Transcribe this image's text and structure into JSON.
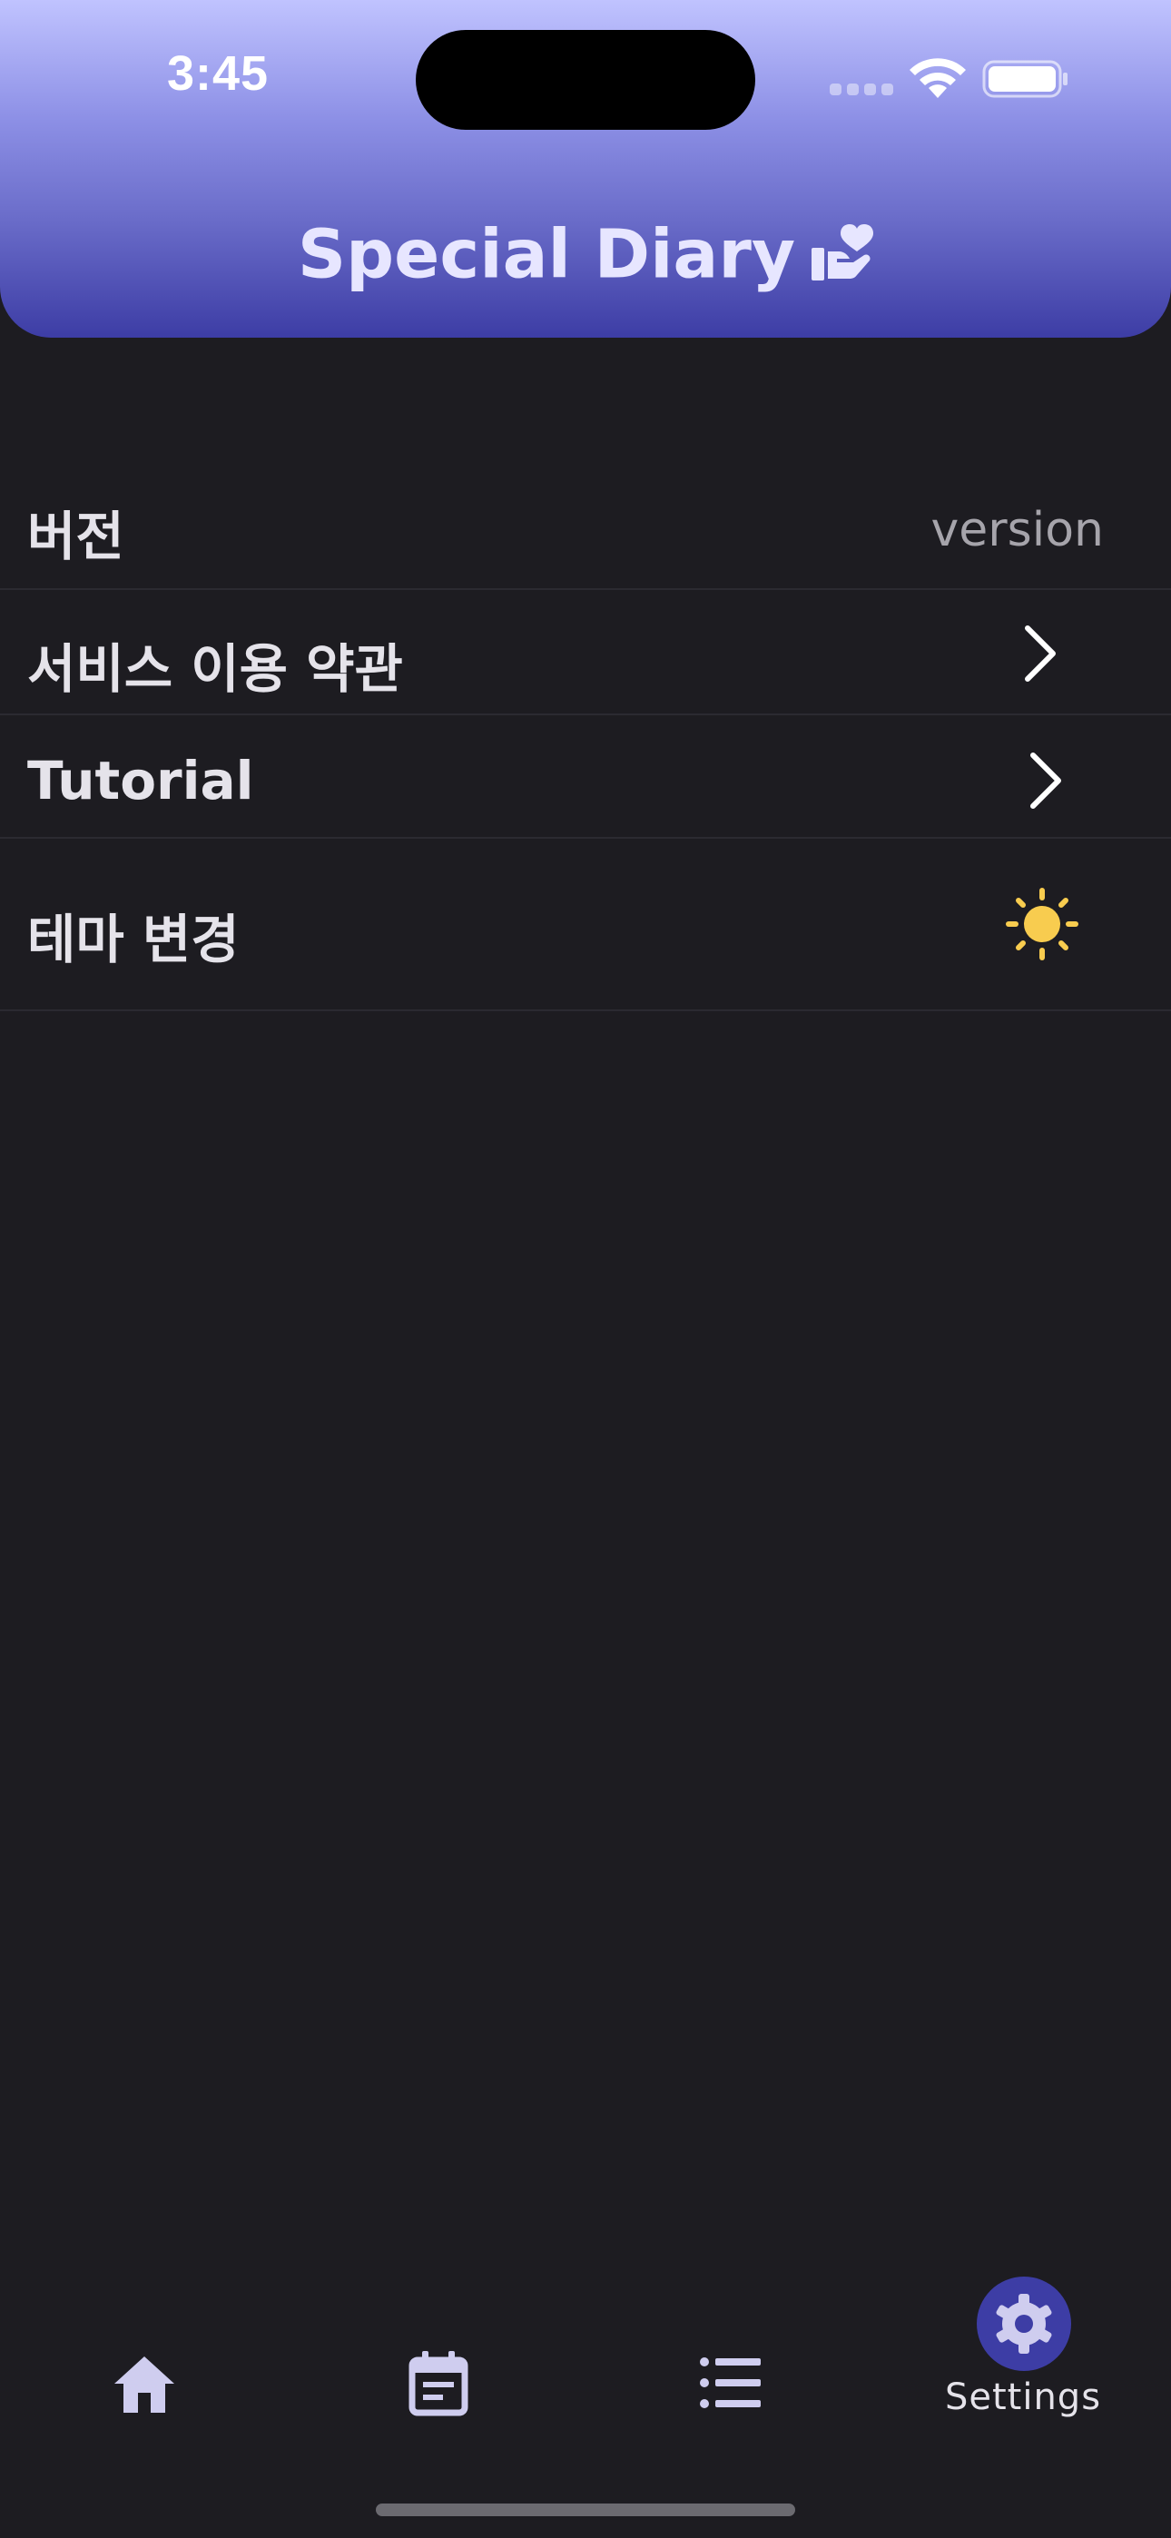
{
  "status_bar": {
    "time": "3:45"
  },
  "header": {
    "title": "Special Diary",
    "title_icon": "heart-hand-icon",
    "gradient_colors": [
      "#c0c3ff",
      "#8d90e6",
      "#6a6cc9",
      "#3d3da5"
    ]
  },
  "settings": {
    "version": {
      "label": "버전",
      "value": "version"
    },
    "terms": {
      "label": "서비스 이용 약관",
      "icon": "chevron-right-icon"
    },
    "tutorial": {
      "label": "Tutorial",
      "icon": "chevron-right-icon"
    },
    "theme": {
      "label": "테마 변경",
      "icon": "sun-icon",
      "icon_color": "#f8cc4f"
    }
  },
  "bottom_nav": {
    "items": [
      {
        "name": "home",
        "icon": "home-icon",
        "label": ""
      },
      {
        "name": "calendar",
        "icon": "calendar-icon",
        "label": ""
      },
      {
        "name": "list",
        "icon": "list-icon",
        "label": ""
      },
      {
        "name": "settings",
        "icon": "gear-icon",
        "label": "Settings",
        "active": true
      }
    ],
    "active_color": "#3d3da5",
    "icon_color": "#cfcdef"
  }
}
